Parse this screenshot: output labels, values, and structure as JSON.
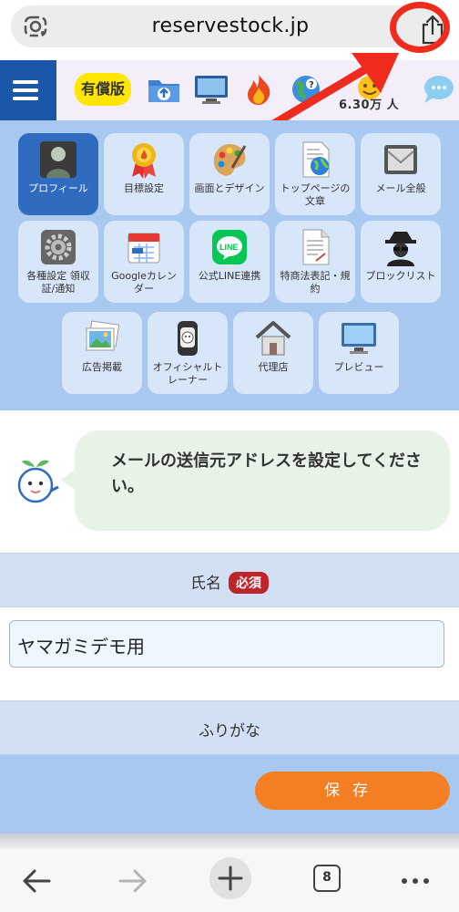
{
  "browser": {
    "url": "reservestock.jp",
    "tab_count": "8"
  },
  "header": {
    "paid_label": "有償版",
    "member_count": "6.30万 人",
    "icons": [
      "folder-upload-icon",
      "monitor-icon",
      "fire-icon",
      "globe-icon",
      "emoji-face-icon",
      "chat-bubble-icon"
    ]
  },
  "menu": {
    "tiles": [
      {
        "label": "プロフィール",
        "icon": "profile-photo-icon",
        "active": true
      },
      {
        "label": "目標設定",
        "icon": "award-medal-icon"
      },
      {
        "label": "画面とデザイン",
        "icon": "palette-icon"
      },
      {
        "label": "トップページの文章",
        "icon": "document-globe-icon"
      },
      {
        "label": "メール全般",
        "icon": "envelope-icon"
      },
      {
        "label": "各種設定 領収証/通知",
        "icon": "gear-icon"
      },
      {
        "label": "Googleカレンダー",
        "icon": "calendar-icon"
      },
      {
        "label": "公式LINE連携",
        "icon": "line-icon"
      },
      {
        "label": "特商法表記・規約",
        "icon": "document-icon"
      },
      {
        "label": "ブロックリスト",
        "icon": "spy-icon"
      },
      {
        "label": "広告掲載",
        "icon": "photos-icon"
      },
      {
        "label": "オフィシャルトレーナー",
        "icon": "trainer-watch-icon"
      },
      {
        "label": "代理店",
        "icon": "house-icon"
      },
      {
        "label": "プレビュー",
        "icon": "preview-monitor-icon"
      }
    ]
  },
  "bubble": {
    "text": "メールの送信元アドレスを設定してください。"
  },
  "form": {
    "name_label": "氏名",
    "required_label": "必須",
    "name_value": "ヤマガミデモ用",
    "furigana_label": "ふりがな",
    "save_label": "保存"
  },
  "colors": {
    "brand_blue": "#1a57a8",
    "menu_bg": "#a8c8f0",
    "required_red": "#c0242b",
    "save_orange": "#f47e22",
    "annotation_red": "#ee2b1d"
  }
}
